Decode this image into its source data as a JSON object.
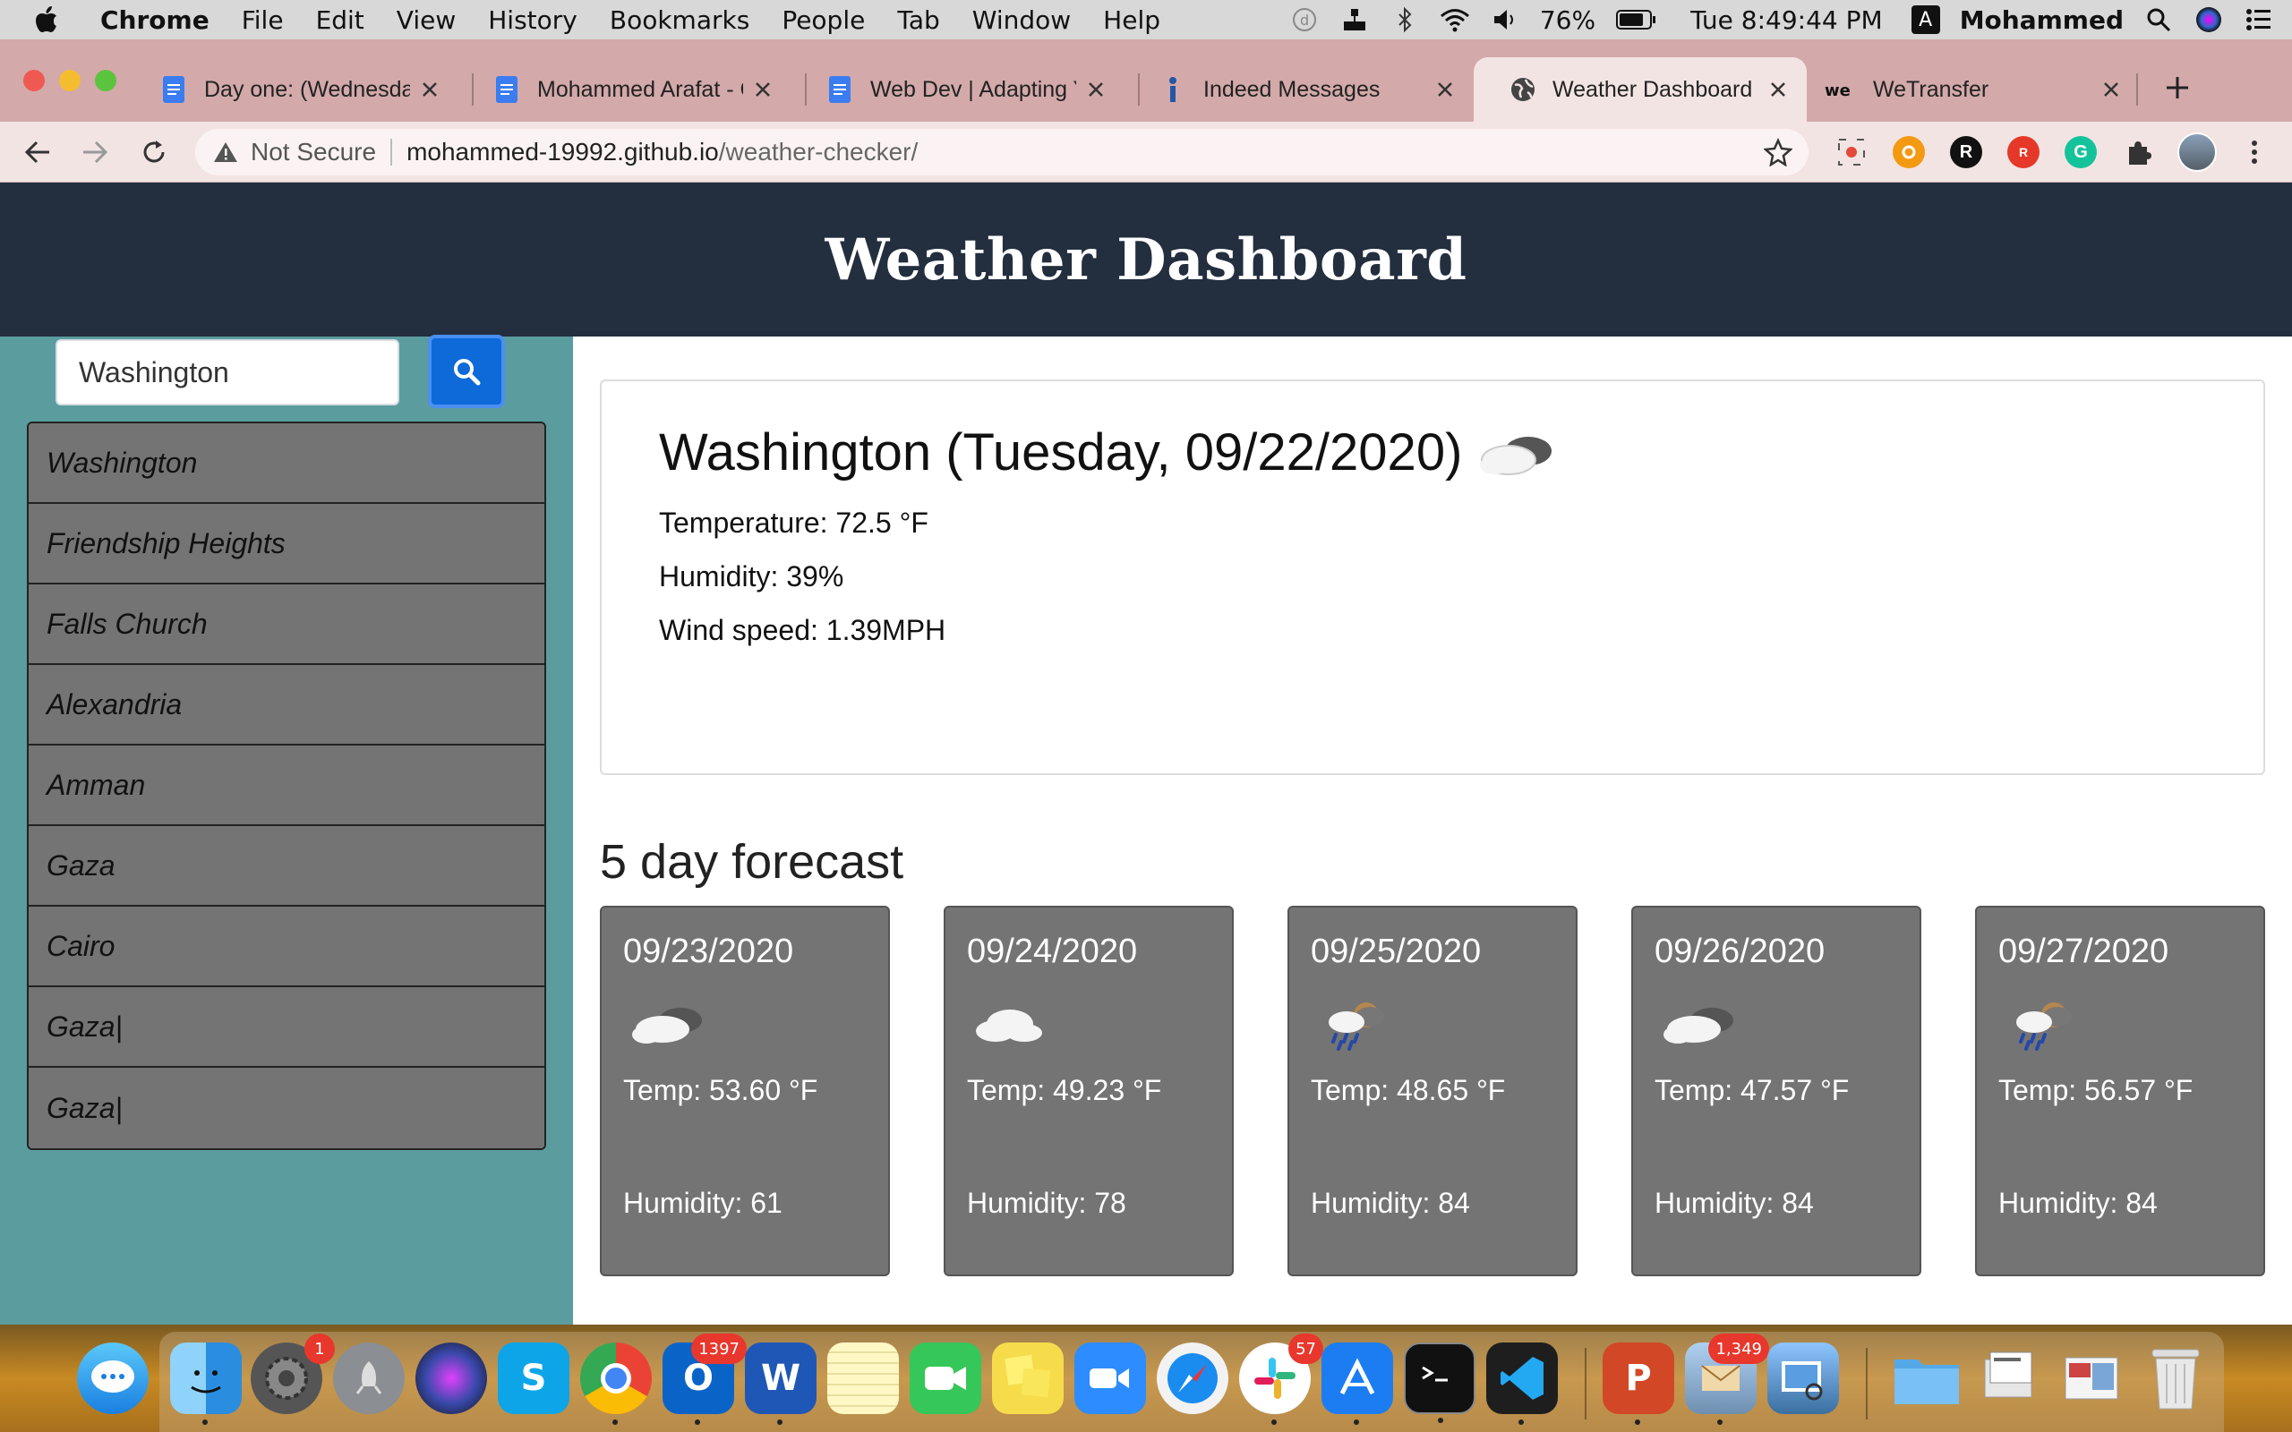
{
  "menubar": {
    "app": "Chrome",
    "items": [
      "File",
      "Edit",
      "View",
      "History",
      "Bookmarks",
      "People",
      "Tab",
      "Window",
      "Help"
    ],
    "battery": "76%",
    "clock": "Tue 8:49:44 PM",
    "input_source": "A",
    "user": "Mohammed"
  },
  "tabs": [
    {
      "label": "Day one: (Wednesday",
      "icon": "docs-icon"
    },
    {
      "label": "Mohammed Arafat - C",
      "icon": "docs-icon"
    },
    {
      "label": "Web Dev | Adapting Y",
      "icon": "docs-icon"
    },
    {
      "label": "Indeed Messages",
      "icon": "indeed-icon"
    },
    {
      "label": "Weather Dashboard",
      "icon": "globe-icon",
      "active": true
    },
    {
      "label": "WeTransfer",
      "icon": "wetransfer-icon"
    }
  ],
  "omnibox": {
    "security": "Not Secure",
    "host": "mohammed-19992.github.io",
    "path": "/weather-checker/"
  },
  "page": {
    "title": "Weather Dashboard",
    "search_value": "Washington",
    "history": [
      "Washington",
      "Friendship Heights",
      "Falls Church",
      "Alexandria",
      "Amman",
      "Gaza",
      "Cairo",
      "Gaza|",
      "Gaza|"
    ],
    "current": {
      "title": "Washington (Tuesday, 09/22/2020)",
      "icon": "partly-cloudy-icon",
      "temperature": "Temperature: 72.5 °F",
      "humidity": "Humidity: 39%",
      "wind": "Wind speed: 1.39MPH"
    },
    "forecast_title": "5 day forecast",
    "forecast": [
      {
        "date": "09/23/2020",
        "icon": "broken-clouds-icon",
        "temp": "Temp: 53.60 °F",
        "humidity": "Humidity: 61"
      },
      {
        "date": "09/24/2020",
        "icon": "cloud-icon",
        "temp": "Temp: 49.23 °F",
        "humidity": "Humidity: 78"
      },
      {
        "date": "09/25/2020",
        "icon": "rain-icon",
        "temp": "Temp: 48.65 °F",
        "humidity": "Humidity: 84"
      },
      {
        "date": "09/26/2020",
        "icon": "broken-clouds-icon",
        "temp": "Temp: 47.57 °F",
        "humidity": "Humidity: 84"
      },
      {
        "date": "09/27/2020",
        "icon": "rain-icon",
        "temp": "Temp: 56.57 °F",
        "humidity": "Humidity: 84"
      }
    ]
  },
  "dock": {
    "badges": {
      "system_preferences": "1",
      "outlook": "1397",
      "slack": "57",
      "mail": "1,349"
    },
    "word_letter": "W",
    "powerpoint_letter": "P",
    "outlook_letter": "O",
    "skype_letter": "S"
  },
  "colors": {
    "header_bg": "#232e3e",
    "sidebar_bg": "#5b9c9f",
    "search_button": "#0d6ad8",
    "card_bg": "#747474",
    "tab_strip": "#d3a9a9"
  }
}
